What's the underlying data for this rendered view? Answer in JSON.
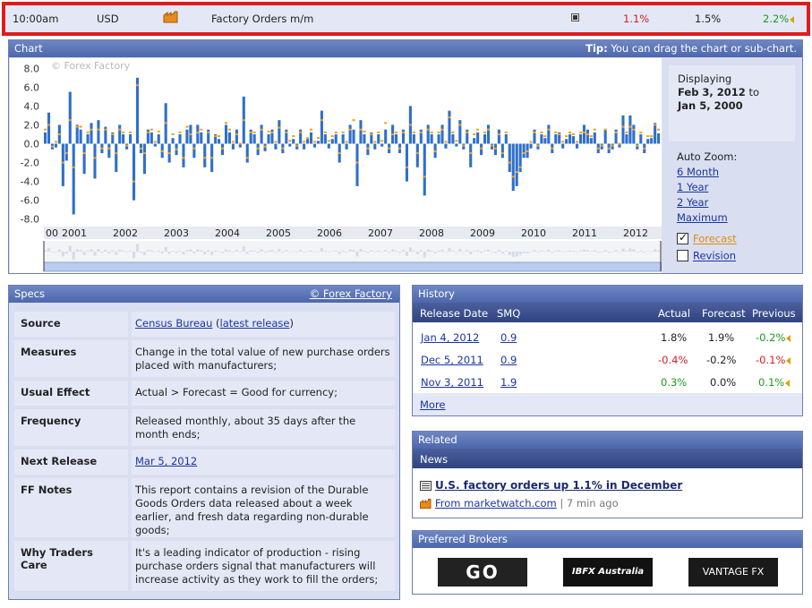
{
  "event": {
    "time": "10:00am",
    "currency": "USD",
    "impact_icon": "factory-icon",
    "name": "Factory Orders m/m",
    "actual": "1.1%",
    "forecast": "1.5%",
    "previous": "2.2%",
    "colors": {
      "actual": "#d41f1f",
      "previous": "#1a9a1a",
      "highlight_border": "#e21b1b"
    }
  },
  "chart_panel": {
    "title": "Chart",
    "tip_label": "Tip:",
    "tip_text": "You can drag the chart or sub-chart.",
    "watermark": "© Forex Factory",
    "displaying_label": "Displaying",
    "range_from": "Feb 3, 2012",
    "range_to_word": "to",
    "range_to": "Jan 5, 2000",
    "auto_zoom_label": "Auto Zoom:",
    "zoom_options": [
      "6 Month",
      "1 Year",
      "2 Year",
      "Maximum"
    ],
    "forecast_label": "Forecast",
    "forecast_checked": true,
    "revision_label": "Revision",
    "revision_checked": false
  },
  "chart_data": {
    "type": "bar",
    "title": "",
    "xlabel": "",
    "ylabel": "",
    "ylim": [
      -8.5,
      8.5
    ],
    "y_ticks": [
      "8.0",
      "6.0",
      "4.0",
      "2.0",
      "0.0",
      "-2.0",
      "-4.0",
      "-6.0",
      "-8.0"
    ],
    "x_ticks": [
      "00",
      "2001",
      "2002",
      "2003",
      "2004",
      "2005",
      "2006",
      "2007",
      "2008",
      "2009",
      "2010",
      "2011",
      "2012"
    ],
    "series": [
      {
        "color": "#2e6fcc",
        "values": [
          1.2,
          3.3,
          -0.6,
          -0.4,
          2.0,
          -4.5,
          -1.8,
          5.5,
          -7.5,
          2.0,
          1.5,
          -3.2,
          1.0,
          2.2,
          -3.7,
          2.5,
          -1.0,
          1.8,
          -1.5,
          1.2,
          -3.0,
          2.0,
          1.0,
          -0.6,
          1.0,
          -6.0,
          7.0,
          -1.0,
          -3.2,
          1.5,
          1.2,
          -0.3,
          1.0,
          -1.5,
          4.3,
          -2.0,
          0.6,
          -1.2,
          1.0,
          -2.5,
          1.5,
          2.0,
          -1.5,
          2.0,
          1.2,
          -2.5,
          1.5,
          -3.0,
          1.0,
          0.5,
          -1.2,
          2.0,
          1.2,
          -0.6,
          1.5,
          -0.4,
          5.0,
          -2.0,
          1.5,
          1.0,
          -1.2,
          2.0,
          -0.8,
          1.0,
          1.5,
          -0.6,
          2.5,
          -1.0,
          1.5,
          -0.3,
          0.5,
          -0.6,
          1.5,
          -0.6,
          0.5,
          1.2,
          -0.4,
          0.3,
          3.5,
          1.0,
          -0.5,
          0.5,
          1.0,
          -2.0,
          1.0,
          -0.6,
          2.0,
          1.5,
          -4.5,
          2.5,
          1.0,
          -1.2,
          1.2,
          -0.6,
          1.0,
          -0.3,
          1.5,
          -1.0,
          2.0,
          1.0,
          -1.0,
          1.5,
          -4.0,
          4.0,
          1.0,
          -2.5,
          1.5,
          -5.5,
          2.0,
          1.0,
          -1.5,
          1.0,
          2.0,
          -0.5,
          3.5,
          1.0,
          -0.3,
          2.5,
          -0.6,
          1.5,
          -2.5,
          0.6,
          1.2,
          -1.2,
          1.0,
          2.0,
          -0.6,
          -1.2,
          1.5,
          -1.5,
          1.0,
          -3.0,
          -5.0,
          -4.5,
          -3.0,
          -1.5,
          -1.5,
          -0.5,
          1.5,
          -0.6,
          1.0,
          0.6,
          2.0,
          -1.0,
          1.0,
          1.2,
          -0.5,
          0.5,
          1.0,
          0.8,
          -0.5,
          1.0,
          2.0,
          1.5,
          0.6,
          1.2,
          -1.0,
          -0.6,
          1.5,
          -1.0,
          -0.6,
          1.5,
          -0.4,
          3.0,
          1.0,
          3.0,
          2.0,
          -0.6,
          1.0,
          -1.0,
          0.5,
          0.6,
          2.2,
          1.1
        ]
      }
    ],
    "forecast_color": "#f0a020",
    "forecast_values": [
      1.5,
      2.0,
      -0.3,
      0.2,
      1.0,
      -2.0,
      -1.0,
      2.5,
      -2.5,
      1.8,
      1.8,
      -1.0,
      1.2,
      1.5,
      -1.5,
      1.5,
      -0.5,
      1.5,
      -0.5,
      1.0,
      -1.0,
      1.5,
      1.2,
      -0.2,
      1.2,
      -4.0,
      6.2,
      -0.5,
      -1.0,
      1.2,
      1.5,
      0.2,
      1.3,
      -0.8,
      2.2,
      -1.0,
      1.0,
      -0.6,
      1.2,
      -1.5,
      1.8,
      1.0,
      -0.5,
      1.2,
      1.5,
      -1.5,
      1.2,
      -1.5,
      0.8,
      0.8,
      -0.5,
      2.2,
      1.5,
      0.2,
      1.0,
      0.0,
      2.5,
      -1.5,
      1.2,
      1.2,
      -0.5,
      1.5,
      -0.3,
      1.3,
      1.2,
      0.2,
      1.7,
      -0.5,
      1.2,
      0.3,
      0.8,
      -0.2,
      1.2,
      0.2,
      0.6,
      1.5,
      0.2,
      0.6,
      2.5,
      1.2,
      0.3,
      0.8,
      1.2,
      -1.0,
      1.2,
      0.2,
      1.5,
      2.5,
      -2.0,
      1.5,
      1.3,
      -0.5,
      1.0,
      0.2,
      1.2,
      0.3,
      2.2,
      -0.5,
      1.0,
      1.2,
      -0.5,
      1.2,
      -2.5,
      2.0,
      1.2,
      -1.0,
      1.2,
      -3.5,
      1.5,
      1.2,
      -0.8,
      1.2,
      1.5,
      0.2,
      2.8,
      1.2,
      0.3,
      2.0,
      -0.2,
      1.2,
      -1.0,
      1.0,
      1.5,
      -0.5,
      1.2,
      1.5,
      -0.2,
      -0.5,
      1.0,
      -1.0,
      1.2,
      -2.0,
      -3.5,
      -3.0,
      -2.5,
      -1.0,
      -0.8,
      0.2,
      1.2,
      -0.2,
      1.2,
      0.8,
      1.5,
      -0.5,
      1.2,
      1.0,
      0.2,
      0.8,
      1.2,
      1.0,
      0.2,
      1.2,
      1.2,
      1.0,
      0.8,
      1.5,
      -0.5,
      -0.2,
      1.5,
      -0.5,
      -0.2,
      1.2,
      0.0,
      1.8,
      1.2,
      1.8,
      1.5,
      -0.2,
      1.2,
      -0.5,
      0.8,
      0.8,
      2.0,
      1.5
    ],
    "grid": false
  },
  "specs": {
    "title": "Specs",
    "credit": "© Forex Factory",
    "rows": [
      {
        "label": "Source",
        "value_link": "Census Bureau",
        "value_extra_prefix": " (",
        "value_extra_link": "latest release",
        "value_extra_suffix": ")"
      },
      {
        "label": "Measures",
        "value": "Change in the total value of new purchase orders placed with manufacturers;"
      },
      {
        "label": "Usual Effect",
        "value": "Actual > Forecast = Good for currency;"
      },
      {
        "label": "Frequency",
        "value": "Released monthly, about 35 days after the month ends;"
      },
      {
        "label": "Next Release",
        "value_link": "Mar 5, 2012"
      },
      {
        "label": "FF Notes",
        "value": "This report contains a revision of the Durable Goods Orders data released about a week earlier, and fresh data regarding non-durable goods;"
      },
      {
        "label": "Why Traders Care",
        "value": "It's a leading indicator of production - rising purchase orders signal that manufacturers will increase activity as they work to fill the orders;"
      }
    ]
  },
  "history": {
    "title": "History",
    "columns": [
      "Release Date",
      "SMQ",
      "Actual",
      "Forecast",
      "Previous"
    ],
    "rows": [
      {
        "date": "Jan 4, 2012",
        "smq": "0.9",
        "actual": "1.8%",
        "actual_color": "#222222",
        "forecast": "1.9%",
        "previous": "-0.2%",
        "previous_color": "#1a9a1a"
      },
      {
        "date": "Dec 5, 2011",
        "smq": "0.9",
        "actual": "-0.4%",
        "actual_color": "#d41f1f",
        "forecast": "-0.2%",
        "previous": "-0.1%",
        "previous_color": "#d41f1f"
      },
      {
        "date": "Nov 3, 2011",
        "smq": "1.9",
        "actual": "0.3%",
        "actual_color": "#1a9a1a",
        "forecast": "0.0%",
        "previous": "0.1%",
        "previous_color": "#1a9a1a"
      }
    ],
    "more_label": "More"
  },
  "related": {
    "title": "Related",
    "news_heading": "News",
    "headline": "U.S. factory orders up 1.1% in December",
    "source_link": "From marketwatch.com",
    "age": "| 7 min ago"
  },
  "brokers": {
    "title": "Preferred Brokers",
    "items": [
      "GO",
      "IBFX Australia",
      "VANTAGE FX"
    ]
  }
}
